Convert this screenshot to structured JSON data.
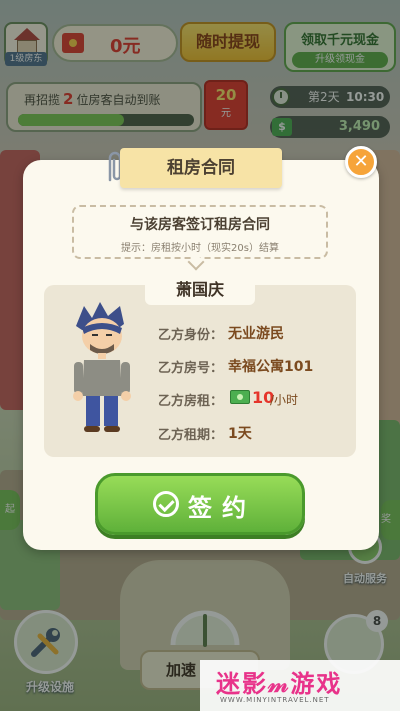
{
  "hud": {
    "house_label": "1级房东",
    "cash_value": "0元",
    "withdraw_label": "随时提现",
    "reward_title": "领取千元现金",
    "reward_subtitle": "升级领现金",
    "progress_prefix": "再招揽",
    "progress_count": "2",
    "progress_suffix": "位房客自动到账",
    "progress_ratio": 0.6,
    "envelope_amount": "20",
    "envelope_unit": "元",
    "day": "第2天",
    "time": "10:30",
    "money": "3,490"
  },
  "dialog": {
    "title": "租房合同",
    "notice_main": "与该房客签订租房合同",
    "notice_hint": "提示：房租按小时（现实20s）结算",
    "tenant_name": "萧国庆",
    "rows": [
      {
        "label": "乙方身份：",
        "value": "无业游民"
      },
      {
        "label": "乙方房号：",
        "value": "幸福公寓101"
      },
      {
        "label": "乙方房租：",
        "value": "10",
        "unit": "/小时"
      },
      {
        "label": "乙方租期：",
        "value": "1天"
      }
    ],
    "sign_label": "签约"
  },
  "bottom": {
    "auto_service": "自动服务",
    "upgrade": "升级设施",
    "speedup": "加速",
    "badge_count": "8",
    "side_left": "起",
    "side_right": "奖"
  },
  "watermark": {
    "text": "迷影𝓂游戏",
    "url": "WWW.MINYINTRAVEL.NET"
  }
}
